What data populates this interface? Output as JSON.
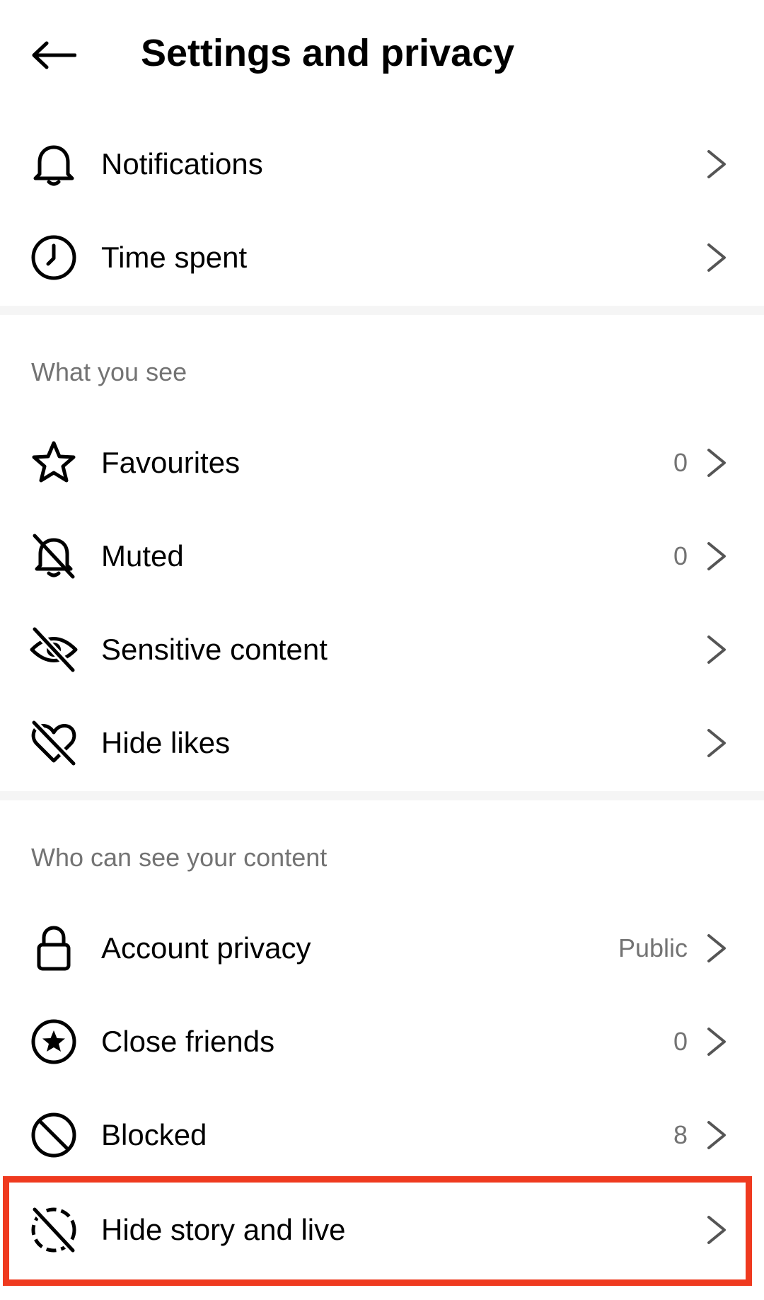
{
  "header": {
    "title": "Settings and privacy"
  },
  "sections": {
    "general": {
      "items": [
        {
          "label": "Notifications",
          "icon": "bell-icon"
        },
        {
          "label": "Time spent",
          "icon": "clock-icon"
        }
      ]
    },
    "what_you_see": {
      "heading": "What you see",
      "items": [
        {
          "label": "Favourites",
          "value": "0",
          "icon": "star-icon"
        },
        {
          "label": "Muted",
          "value": "0",
          "icon": "muted-bell-icon"
        },
        {
          "label": "Sensitive content",
          "icon": "eye-off-icon"
        },
        {
          "label": "Hide likes",
          "icon": "heart-off-icon"
        }
      ]
    },
    "who_can_see": {
      "heading": "Who can see your content",
      "items": [
        {
          "label": "Account privacy",
          "value": "Public",
          "icon": "lock-icon"
        },
        {
          "label": "Close friends",
          "value": "0",
          "icon": "star-circle-icon"
        },
        {
          "label": "Blocked",
          "value": "8",
          "icon": "blocked-icon"
        },
        {
          "label": "Hide story and live",
          "icon": "story-off-icon"
        }
      ]
    }
  },
  "highlight": {
    "color": "#ef3a1f",
    "target": "Hide story and live"
  },
  "colors": {
    "secondary_text": "#737373",
    "divider": "#f5f5f5"
  }
}
